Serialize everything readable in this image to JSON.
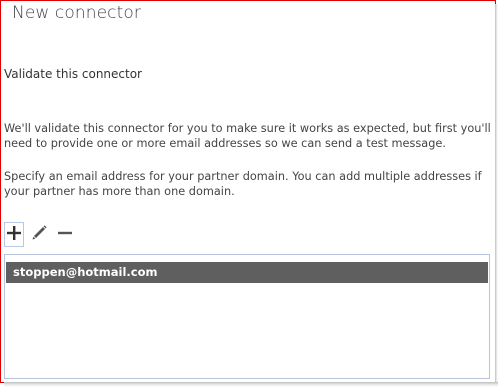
{
  "window": {
    "title": "New connector"
  },
  "section": {
    "heading": "Validate this connector",
    "intro": "We'll validate this connector for you to make sure it works as expected, but first you'll need to provide one or more email addresses so we can send a test message.",
    "instructions": "Specify an email address for your partner domain. You can add multiple addresses if your partner has more than one domain."
  },
  "toolbar": {
    "add_icon": "plus-icon",
    "edit_icon": "pencil-icon",
    "remove_icon": "minus-icon"
  },
  "email_list": {
    "items": [
      "stoppen@hotmail.com"
    ],
    "selected_index": 0
  },
  "colors": {
    "selection_bg": "#5f5f5f",
    "frame_border": "#e00000",
    "list_border": "#b8c4dc"
  }
}
